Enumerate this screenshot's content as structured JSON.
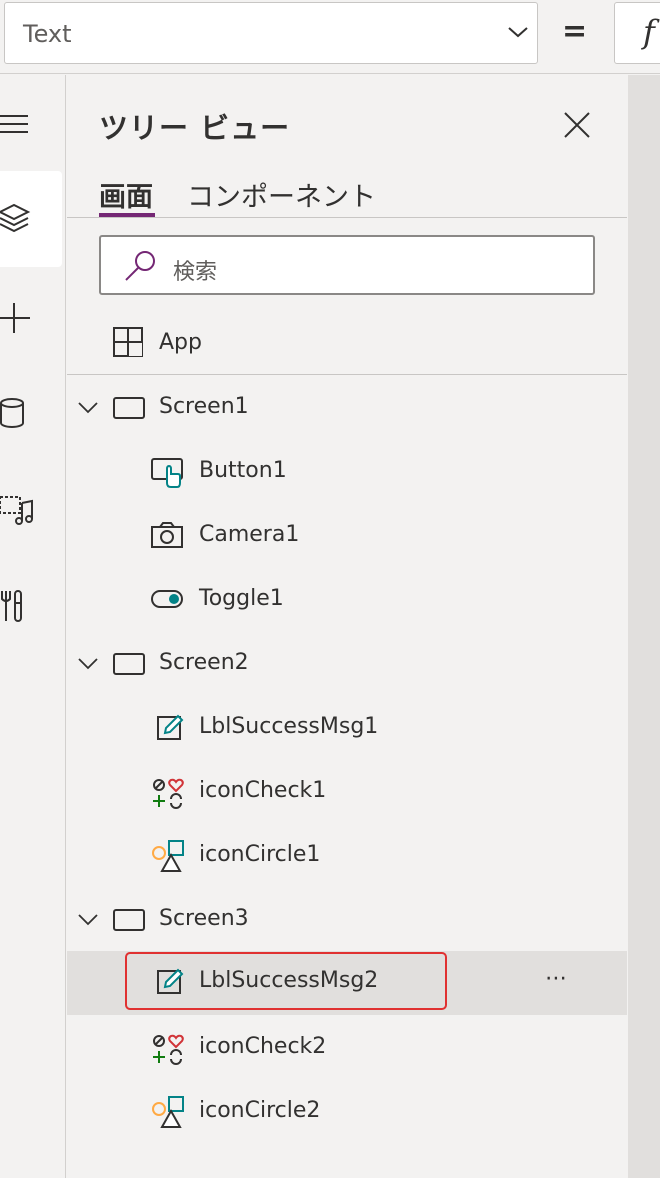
{
  "formula_bar": {
    "property_value": "Text",
    "equals": "=",
    "fx": "f"
  },
  "rail": {
    "items": [
      "hamburger-menu-icon",
      "layers-icon",
      "plus-icon",
      "database-icon",
      "media-icon",
      "tools-icon"
    ]
  },
  "tree_view": {
    "title": "ツリー ビュー",
    "tabs": [
      {
        "label": "画面",
        "active": true
      },
      {
        "label": "コンポーネント",
        "active": false
      }
    ],
    "search_placeholder": "検索",
    "app_label": "App",
    "screens": [
      {
        "name": "Screen1",
        "children": [
          "Button1",
          "Camera1",
          "Toggle1"
        ]
      },
      {
        "name": "Screen2",
        "children": [
          "LblSuccessMsg1",
          "iconCheck1",
          "iconCircle1"
        ]
      },
      {
        "name": "Screen3",
        "children": [
          "LblSuccessMsg2",
          "iconCheck2",
          "iconCircle2"
        ]
      }
    ],
    "selected_item": "LblSuccessMsg2",
    "more_label": "⋯"
  },
  "colors": {
    "accent": "#742774",
    "highlight_border": "#e03131",
    "toggle_teal": "#038387"
  }
}
